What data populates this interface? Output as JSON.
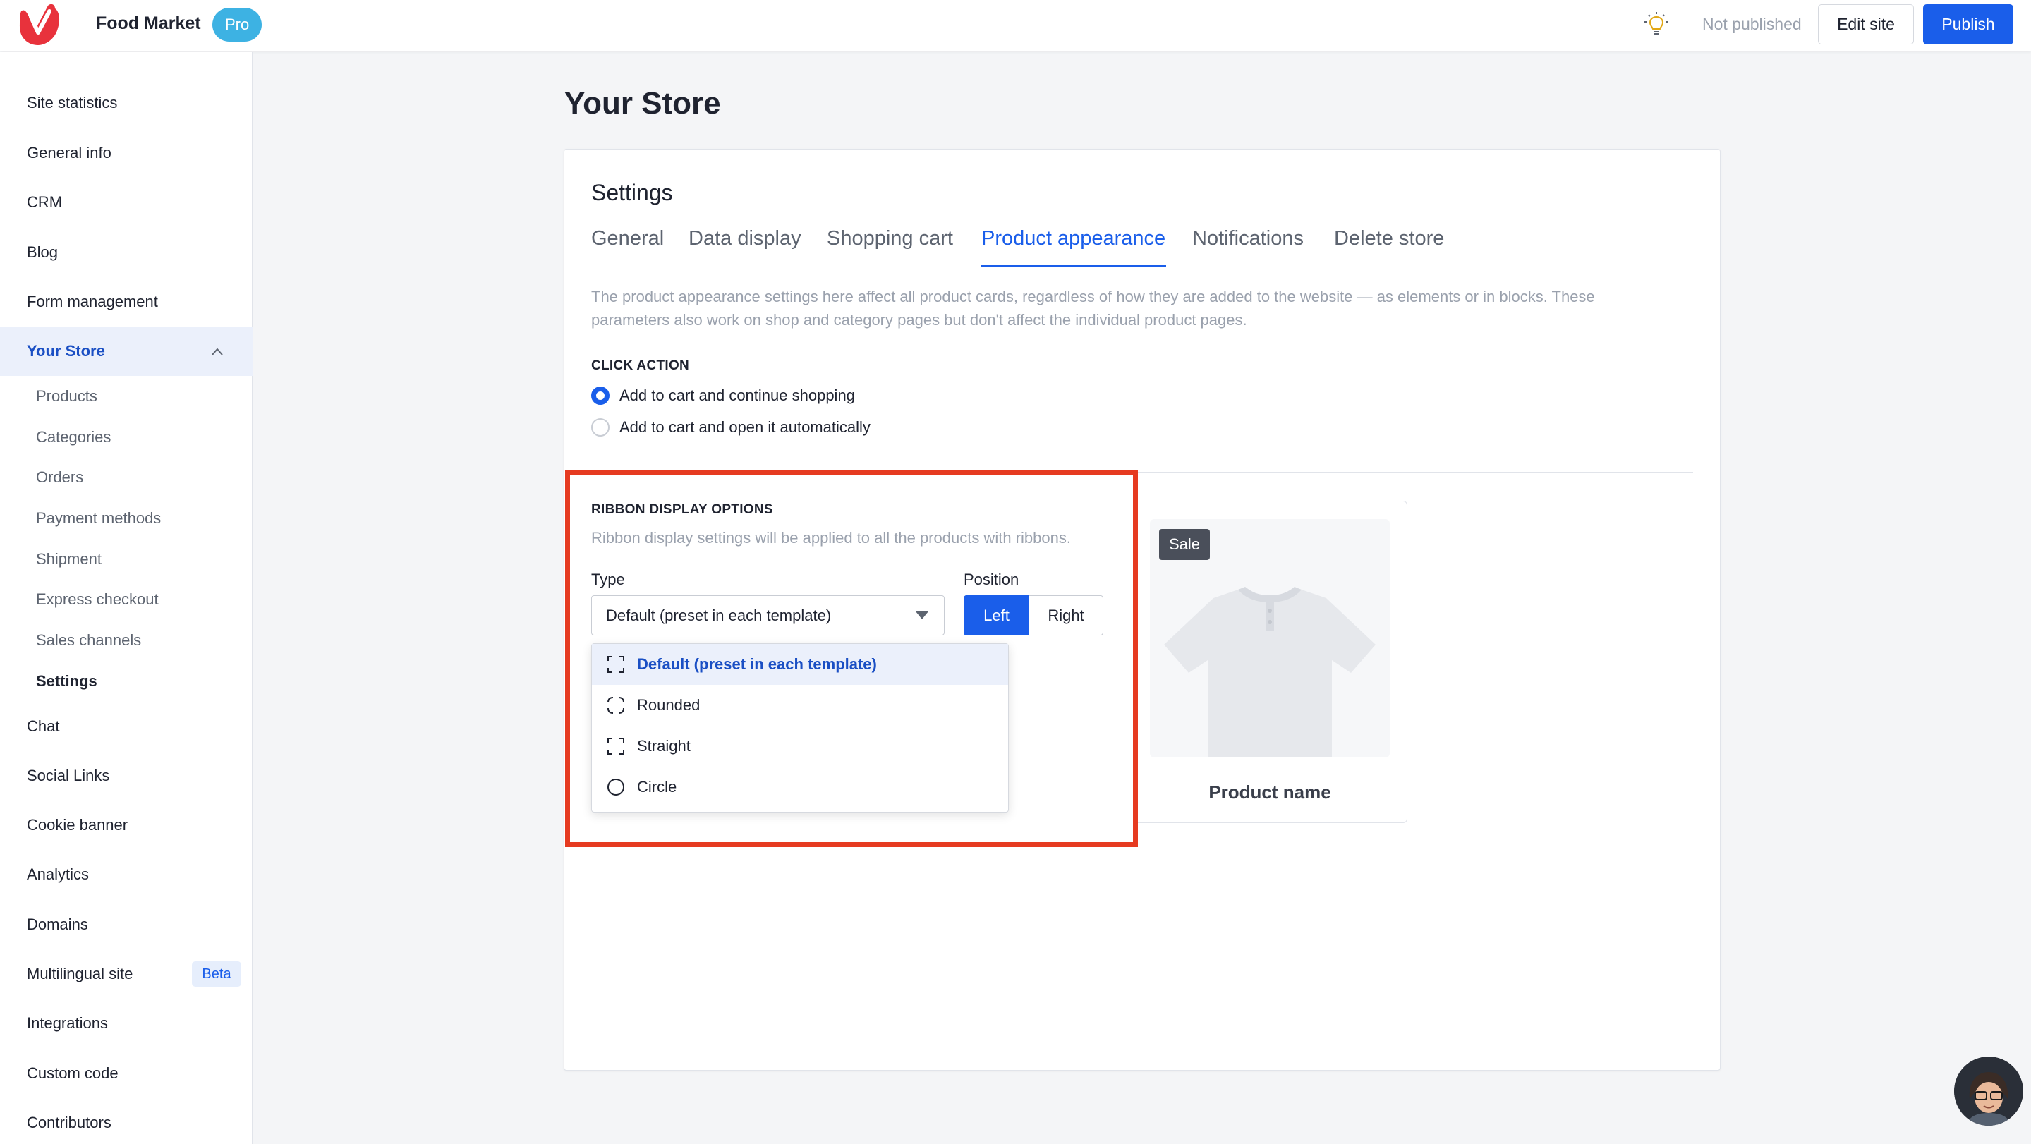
{
  "topbar": {
    "site_name": "Food Market",
    "plan_badge": "Pro",
    "status": "Not published",
    "edit_label": "Edit site",
    "publish_label": "Publish",
    "accent_color": "#1a5eea"
  },
  "sidebar": {
    "items": [
      {
        "label": "Site statistics"
      },
      {
        "label": "General info"
      },
      {
        "label": "CRM"
      },
      {
        "label": "Blog"
      },
      {
        "label": "Form management"
      },
      {
        "label": "Your Store"
      },
      {
        "label": "Chat"
      },
      {
        "label": "Social Links"
      },
      {
        "label": "Cookie banner"
      },
      {
        "label": "Analytics"
      },
      {
        "label": "Domains"
      },
      {
        "label": "Multilingual site",
        "badge": "Beta"
      },
      {
        "label": "Integrations"
      },
      {
        "label": "Custom code"
      },
      {
        "label": "Contributors"
      }
    ],
    "store_subitems": [
      {
        "label": "Products"
      },
      {
        "label": "Categories"
      },
      {
        "label": "Orders"
      },
      {
        "label": "Payment methods"
      },
      {
        "label": "Shipment"
      },
      {
        "label": "Express checkout"
      },
      {
        "label": "Sales channels"
      },
      {
        "label": "Settings"
      }
    ]
  },
  "main": {
    "page_title": "Your Store",
    "settings_heading": "Settings",
    "tabs": [
      {
        "label": "General"
      },
      {
        "label": "Data display"
      },
      {
        "label": "Shopping cart"
      },
      {
        "label": "Product appearance"
      },
      {
        "label": "Notifications"
      },
      {
        "label": "Delete store"
      }
    ],
    "active_tab": "Product appearance",
    "description": "The product appearance settings here affect all product cards, regardless of how they are added to the website — as elements or in blocks. These parameters also work on shop and category pages but don't affect the individual product pages.",
    "click_action": {
      "label": "CLICK ACTION",
      "options": [
        {
          "label": "Add to cart and continue shopping",
          "selected": true
        },
        {
          "label": "Add to cart and open it automatically",
          "selected": false
        }
      ]
    },
    "ribbon": {
      "label": "RIBBON DISPLAY OPTIONS",
      "hint": "Ribbon display settings will be applied to all the products with ribbons.",
      "type_label": "Type",
      "type_value": "Default (preset in each template)",
      "position_label": "Position",
      "position_options": [
        "Left",
        "Right"
      ],
      "position_selected": "Left",
      "dropdown_options": [
        {
          "label": "Default (preset in each template)",
          "icon": "corners-default-icon",
          "selected": true
        },
        {
          "label": "Rounded",
          "icon": "corners-rounded-icon",
          "selected": false
        },
        {
          "label": "Straight",
          "icon": "corners-straight-icon",
          "selected": false
        },
        {
          "label": "Circle",
          "icon": "circle-icon",
          "selected": false
        }
      ]
    },
    "preview": {
      "badge": "Sale",
      "product_name": "Product name"
    }
  }
}
